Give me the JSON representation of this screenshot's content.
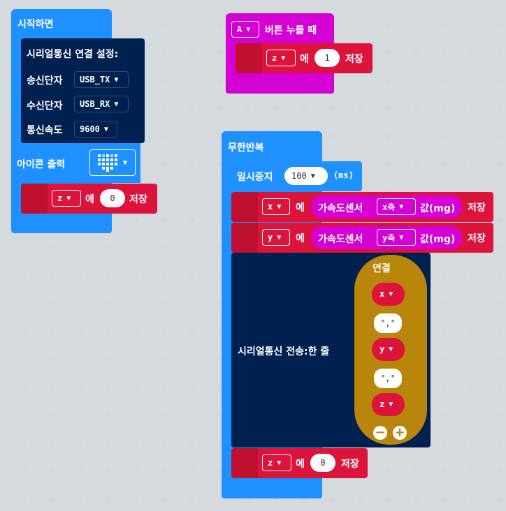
{
  "on_start": {
    "hat_label": "시작하면",
    "serial_setup_label": "시리얼통신 연결 설정:",
    "tx_label": "송신단자",
    "tx_value": "USB_TX",
    "rx_label": "수신단자",
    "rx_value": "USB_RX",
    "baud_label": "통신속도",
    "baud_value": "9600",
    "show_icon_label": "아이콘 출력",
    "set_var": {
      "var": "z",
      "to_label": "에",
      "value": "0",
      "save_label": "저장"
    }
  },
  "on_button": {
    "button_value": "A",
    "press_label": "버튼 누를 때",
    "set_var": {
      "var": "z",
      "to_label": "에",
      "value": "1",
      "save_label": "저장"
    }
  },
  "forever": {
    "hat_label": "무한반복",
    "pause_label": "일시중지",
    "pause_value": "100",
    "pause_unit": "(ms)",
    "set_x": {
      "var": "x",
      "to_label": "에",
      "sensor_label": "가속도센서",
      "axis": "x축",
      "unit_label": "값(mg)",
      "save_label": "저장"
    },
    "set_y": {
      "var": "y",
      "to_label": "에",
      "sensor_label": "가속도센서",
      "axis": "y축",
      "unit_label": "값(mg)",
      "save_label": "저장"
    },
    "serial_write_label": "시리얼통신 전송:한 줄",
    "join_label": "연결",
    "join_items": [
      "x",
      "\",\"",
      "y",
      "\",\"",
      "z"
    ],
    "set_z": {
      "var": "z",
      "to_label": "에",
      "value": "0",
      "save_label": "저장"
    }
  },
  "colors": {
    "basic": "#1e90ff",
    "variables": "#dc143c",
    "serial": "#002050",
    "input": "#d400d4",
    "text": "#b8860b",
    "workspace": "#ecf0f1"
  },
  "icons": [
    "dropdown-arrow-icon",
    "heart-icon",
    "remove-item-icon",
    "add-item-icon"
  ]
}
